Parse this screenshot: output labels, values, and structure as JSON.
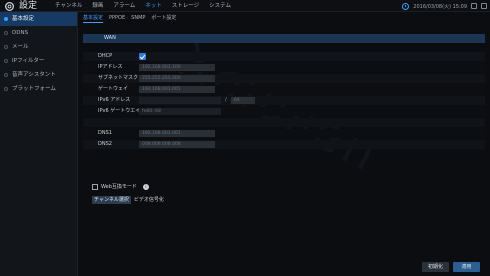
{
  "app": {
    "title": "設定"
  },
  "topnav": [
    {
      "label": "チャンネル",
      "active": false
    },
    {
      "label": "録画",
      "active": false
    },
    {
      "label": "アラーム",
      "active": false
    },
    {
      "label": "ネット",
      "active": true
    },
    {
      "label": "ストレージ",
      "active": false
    },
    {
      "label": "システム",
      "active": false
    }
  ],
  "top_right": {
    "datetime": "2016/03/08(火) 15:09"
  },
  "sidebar": [
    {
      "label": "基本設定",
      "active": true
    },
    {
      "label": "DDNS",
      "active": false
    },
    {
      "label": "メール",
      "active": false
    },
    {
      "label": "IPフィルター",
      "active": false
    },
    {
      "label": "音声アシスタント",
      "active": false
    },
    {
      "label": "プラットフォーム",
      "active": false
    }
  ],
  "subtabs": [
    {
      "label": "基本設定",
      "active": true
    },
    {
      "label": "PPPOE",
      "active": false
    },
    {
      "label": "SNMP",
      "active": false
    },
    {
      "label": "ポート設定",
      "active": false
    }
  ],
  "form": {
    "section": "WAN",
    "dhcp_label": "DHCP",
    "dhcp_checked": true,
    "ip_label": "IPアドレス",
    "ip_value": "192.168.001.100",
    "mask_label": "サブネットマスク",
    "mask_value": "255.255.255.000",
    "gateway_label": "ゲートウェイ",
    "gateway_value": "192.168.001.001",
    "ipv6_label": "IPv6 アドレス",
    "ipv6_value": "",
    "ipv6_slash": "/",
    "ipv6_prefix": "64",
    "ipv6_gw_label": "IPv6 ゲートウエイ",
    "ipv6_gw_value": "fe80::68",
    "dns1_label": "DNS1",
    "dns1_value": "192.168.001.001",
    "dns2_label": "DNS2",
    "dns2_value": "008.008.008.008"
  },
  "options": {
    "web_mode_label": "Web互換モード",
    "web_mode_checked": false,
    "info_glyph": "i",
    "channel_button": "チャンネル選択",
    "channel_text": "ビデオ信号化"
  },
  "buttons": {
    "default": "初期化",
    "apply": "適用"
  },
  "watermark": "Xmusen"
}
